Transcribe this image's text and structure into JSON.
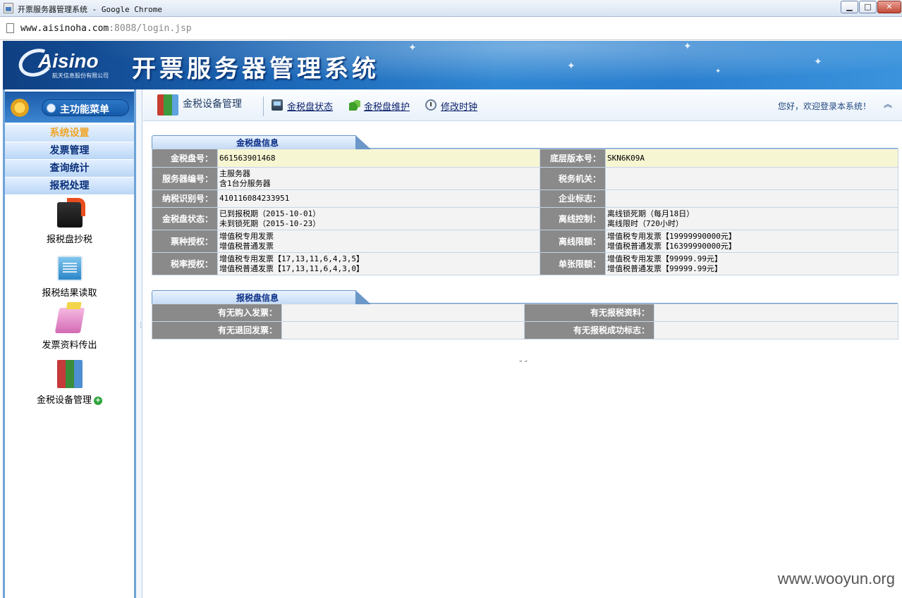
{
  "window": {
    "title": "开票服务器管理系统 - Google Chrome",
    "minimize": "▁",
    "maximize": "□",
    "close": "✕"
  },
  "address_bar": {
    "host": "www.aisinoha.com",
    "rest": ":8088/login.jsp"
  },
  "banner": {
    "logo_text": "Aisino",
    "logo_subtitle": "航天信息股份有限公司",
    "title": "开票服务器管理系统"
  },
  "sidebar": {
    "header": "主功能菜单",
    "menu": [
      {
        "label": "系统设置",
        "active": true
      },
      {
        "label": "发票管理",
        "active": false
      },
      {
        "label": "查询统计",
        "active": false
      },
      {
        "label": "报税处理",
        "active": false
      }
    ],
    "tools": [
      {
        "label": "报税盘抄税",
        "icon": "copy-tax-icon"
      },
      {
        "label": "报税结果读取",
        "icon": "monitor-icon"
      },
      {
        "label": "发票资料传出",
        "icon": "folder-icon"
      },
      {
        "label": "金税设备管理",
        "icon": "books-icon"
      }
    ]
  },
  "toolbar": {
    "section_title": "金税设备管理",
    "links": [
      "金税盘状态",
      "金税盘维护",
      "修改时钟"
    ],
    "welcome": "您好，欢迎登录本系统！",
    "collapse": "︽"
  },
  "golden_tax_panel": {
    "tab": "金税盘信息",
    "rows": [
      {
        "l1": "金税盘号：",
        "v1": "661563901468",
        "l2": "底层版本号：",
        "v2": "SKN6K09A"
      },
      {
        "l1": "服务器编号：",
        "v1": "主服务器\n含1台分服务器",
        "l2": "税务机关：",
        "v2": ""
      },
      {
        "l1": "纳税识别号：",
        "v1": "410116084233951",
        "l2": "企业标志：",
        "v2": ""
      },
      {
        "l1": "金税盘状态：",
        "v1": "已到报税期（2015-10-01）\n未到锁死期（2015-10-23）",
        "l2": "离线控制：",
        "v2": "离线锁死期（每月18日）\n离线限时（720小时）"
      },
      {
        "l1": "票种授权：",
        "v1": "增值税专用发票\n增值税普通发票",
        "l2": "离线限额：",
        "v2": "增值税专用发票【19999990000元】\n增值税普通发票【16399990000元】"
      },
      {
        "l1": "税率授权：",
        "v1": "增值税专用发票【17,13,11,6,4,3,5】\n增值税普通发票【17,13,11,6,4,3,0】",
        "l2": "单张限额：",
        "v2": "增值税专用发票【99999.99元】\n增值税普通发票【99999.99元】"
      }
    ]
  },
  "tax_disk_panel": {
    "tab": "报税盘信息",
    "rows": [
      {
        "l1": "有无购入发票：",
        "v1": "",
        "l2": "有无报税资料：",
        "v2": ""
      },
      {
        "l1": "有无退回发票：",
        "v1": "",
        "l2": "有无报税成功标志：",
        "v2": ""
      }
    ]
  },
  "footmark": "„ „",
  "watermark": "www.wooyun.org"
}
